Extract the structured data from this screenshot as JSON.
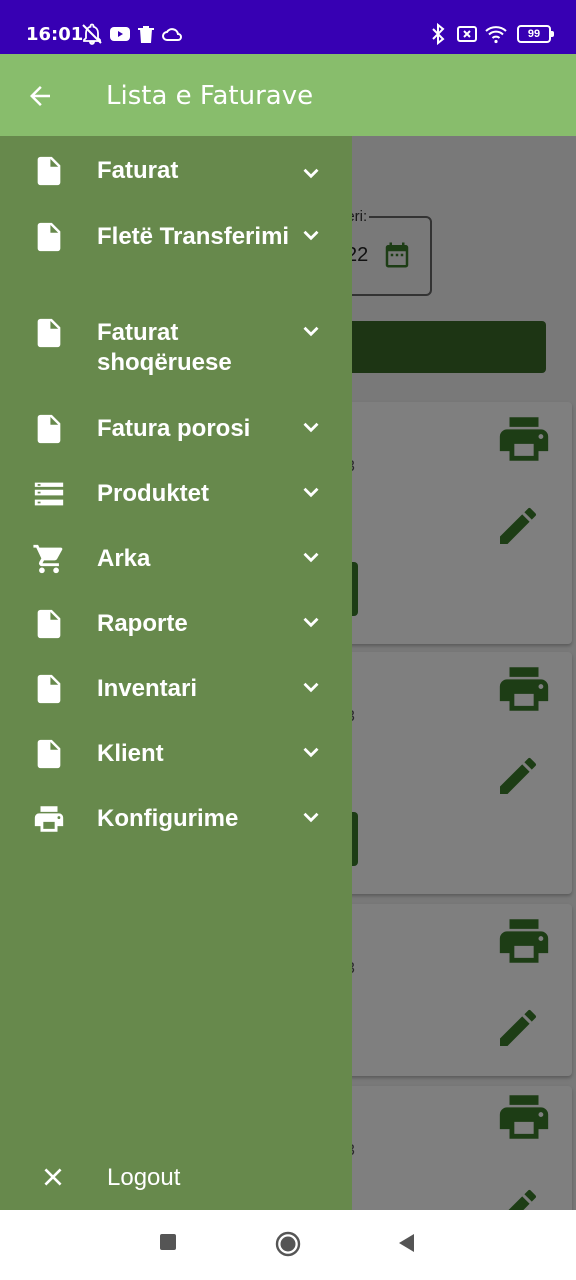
{
  "status_bar": {
    "time": "16:01",
    "battery": "99",
    "icons": [
      "notifications-off-icon",
      "youtube-icon",
      "trash-icon",
      "cloud-icon",
      "bluetooth-icon",
      "sim-icon",
      "wifi-icon",
      "battery-icon"
    ]
  },
  "app_bar": {
    "back_icon": "arrow-back-icon",
    "title": "Lista e Faturave"
  },
  "background": {
    "date_label": "deri:",
    "date_value": "22",
    "cards": [
      {
        "text": "3",
        "icons": [
          "print-icon",
          "edit-icon"
        ]
      },
      {
        "text": "3",
        "icons": [
          "print-icon",
          "edit-icon"
        ]
      },
      {
        "text": "3",
        "icons": [
          "print-icon",
          "edit-icon"
        ]
      },
      {
        "text": "3",
        "icons": [
          "print-icon",
          "edit-icon"
        ]
      }
    ]
  },
  "drawer": {
    "items": [
      {
        "label": "Faturat",
        "icon": "document-icon"
      },
      {
        "label": "Fletë Transferimi",
        "icon": "document-icon"
      },
      {
        "label": "Faturat shoqëruese",
        "icon": "document-icon"
      },
      {
        "label": "Fatura porosi",
        "icon": "document-icon"
      },
      {
        "label": "Produktet",
        "icon": "list-icon"
      },
      {
        "label": "Arka",
        "icon": "cart-icon"
      },
      {
        "label": "Raporte",
        "icon": "document-icon"
      },
      {
        "label": "Inventari",
        "icon": "document-icon"
      },
      {
        "label": "Klient",
        "icon": "document-icon"
      },
      {
        "label": "Konfigurime",
        "icon": "printer-icon"
      }
    ],
    "logout_label": "Logout"
  },
  "colors": {
    "status_bar": "#3700b3",
    "app_bar": "#88bd6c",
    "drawer": "#67894c",
    "accent": "#3a7a2a"
  }
}
